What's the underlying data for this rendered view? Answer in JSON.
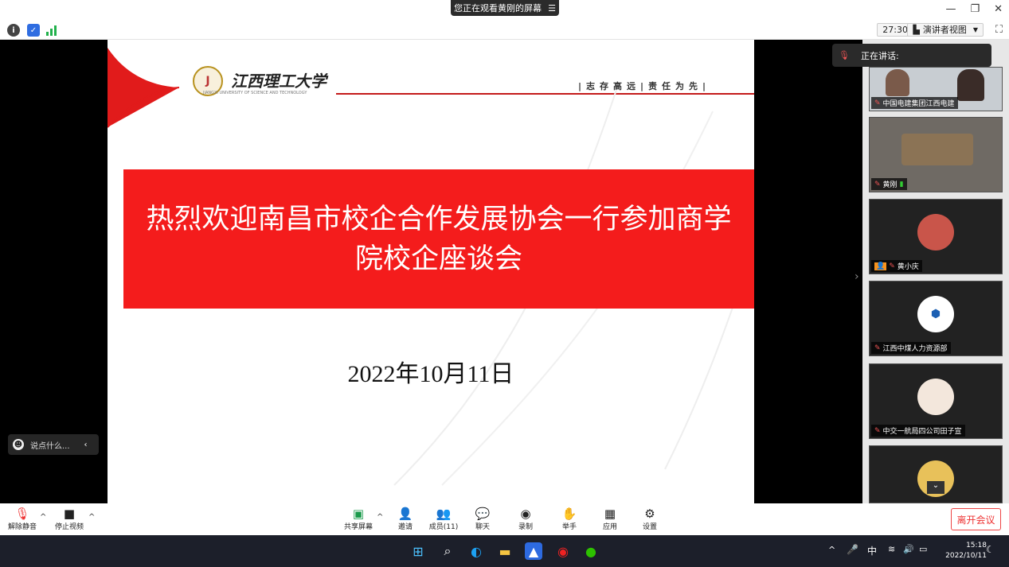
{
  "window": {
    "share_banner": "您正在观看黄刚的屏幕",
    "minimize": "—",
    "restore": "❐",
    "close": "✕"
  },
  "infobar": {
    "timer": "27:30",
    "view_mode": "演讲者视图"
  },
  "slide": {
    "university_name": "江西理工大学",
    "university_sub": "JIANGXI UNIVERSITY OF SCIENCE AND TECHNOLOGY",
    "motto": "|志存高远|责任为先|",
    "title": "热烈欢迎南昌市校企合作发展协会一行参加商学院校企座谈会",
    "date": "2022年10月11日"
  },
  "comment": {
    "placeholder": "说点什么..."
  },
  "side": {
    "talking_label": "正在讲话:",
    "participants": [
      {
        "name": "中国电建集团江西电建"
      },
      {
        "name": "黄刚"
      },
      {
        "name": "黄小庆"
      },
      {
        "name": "江西中煤人力资源部"
      },
      {
        "name": "中交一航局四公司田子宣"
      },
      {
        "name": ""
      }
    ]
  },
  "toolbar": {
    "unmute": "解除静音",
    "stop_video": "停止视频",
    "share": "共享屏幕",
    "invite": "邀请",
    "members": "成员(11)",
    "chat": "聊天",
    "record": "录制",
    "raise_hand": "举手",
    "apps": "应用",
    "settings": "设置",
    "leave": "离开会议"
  },
  "taskbar": {
    "ime": "中",
    "time": "15:18",
    "date": "2022/10/11"
  },
  "colors": {
    "slide_red": "#f41c1c",
    "leave_red": "#e33333"
  }
}
